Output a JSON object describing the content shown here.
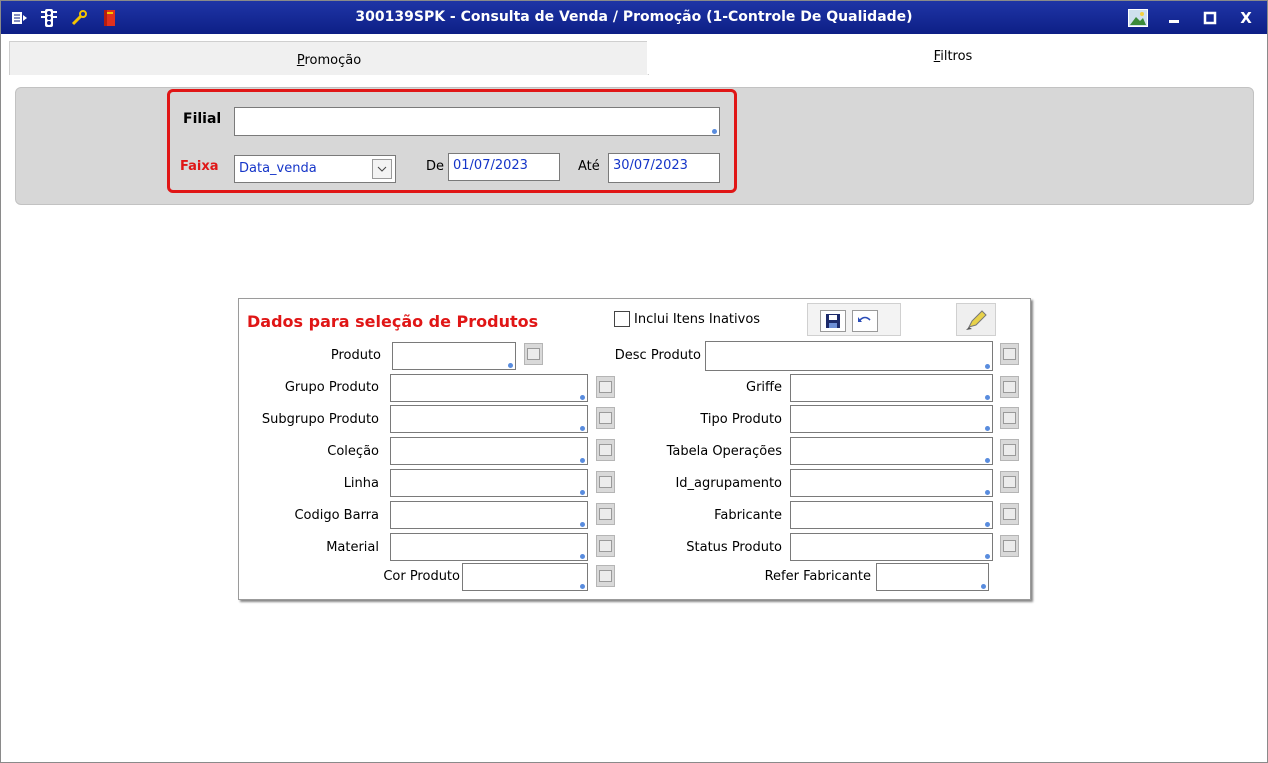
{
  "window": {
    "title": "300139SPK - Consulta de Venda / Promoção (1-Controle De Qualidade)",
    "close_glyph": "X"
  },
  "toolbar_icons": [
    "list-icon",
    "traffic-light-icon",
    "wrench-icon",
    "book-icon"
  ],
  "tabs": [
    {
      "label_first": "P",
      "label_rest": "romoção",
      "active": false
    },
    {
      "label_first": "F",
      "label_rest": "iltros",
      "active": true
    }
  ],
  "filters": {
    "filial_label": "Filial",
    "filial_value": "",
    "faixa_label": "Faixa",
    "faixa_value": "Data_venda",
    "de_label": "De",
    "de_value": "01/07/2023",
    "ate_label": "Até",
    "ate_value": "30/07/2023"
  },
  "produtos": {
    "title": "Dados para seleção de Produtos",
    "inativos_label": "Inclui Itens Inativos",
    "left_fields": [
      "Produto",
      "Grupo Produto",
      "Subgrupo Produto",
      "Coleção",
      "Linha",
      "Codigo Barra",
      "Material",
      "Cor Produto"
    ],
    "right_fields": [
      "Desc Produto",
      "Griffe",
      "Tipo Produto",
      "Tabela Operações",
      "Id_agrupamento",
      "Fabricante",
      "Status Produto",
      "Refer Fabricante"
    ]
  },
  "colors": {
    "titlebar": "#0d1f86",
    "accent_red": "#e01616",
    "value_blue": "#1535c8"
  }
}
